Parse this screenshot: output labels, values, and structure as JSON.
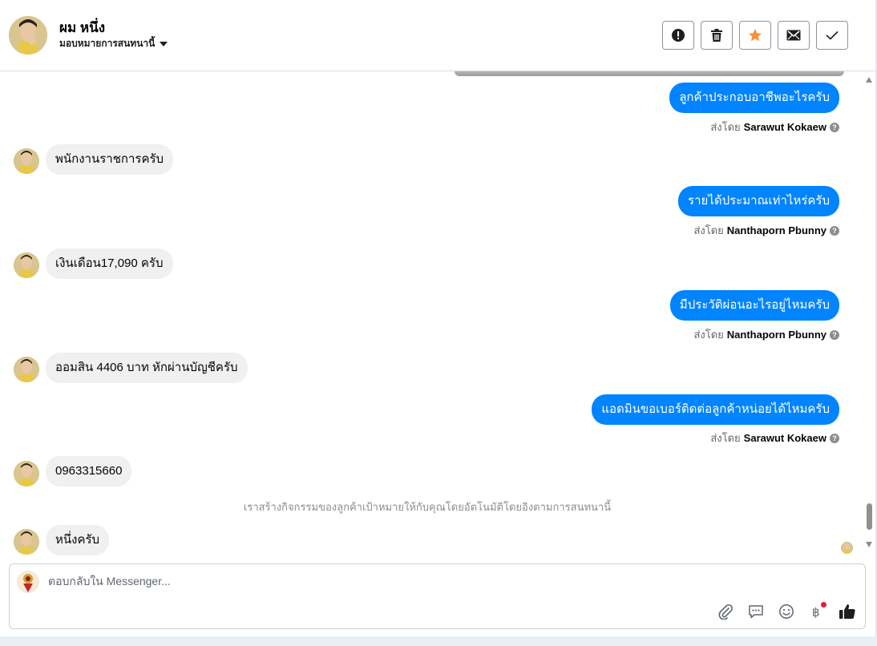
{
  "header": {
    "name": "ผม หนึ่ง",
    "subtitle": "มอบหมายการสนทนานี้",
    "actions": [
      {
        "name": "mark-spam-icon"
      },
      {
        "name": "trash-icon"
      },
      {
        "name": "star-icon",
        "color": "#f7923b"
      },
      {
        "name": "envelope-icon"
      },
      {
        "name": "checkmark-icon"
      }
    ]
  },
  "messages": [
    {
      "dir": "out",
      "text": "ลูกค้าประกอบอาชีพอะไรครับ",
      "sent_by_label": "ส่งโดย",
      "sender": "Sarawut Kokaew"
    },
    {
      "dir": "in",
      "text": "พนักงานราชการครับ"
    },
    {
      "dir": "out",
      "text": "รายได้ประมาณเท่าไหร่ครับ",
      "sent_by_label": "ส่งโดย",
      "sender": "Nanthaporn Pbunny"
    },
    {
      "dir": "in",
      "text": "เงินเดือน17,090 ครับ"
    },
    {
      "dir": "out",
      "text": "มีประวัติผ่อนอะไรอยู่ไหมครับ",
      "sent_by_label": "ส่งโดย",
      "sender": "Nanthaporn Pbunny"
    },
    {
      "dir": "in",
      "text": "ออมสิน 4406 บาท หักผ่านบัญชีครับ"
    },
    {
      "dir": "out",
      "text": "แอดมินขอเบอร์ติดต่อลูกค้าหน่อยได้ไหมครับ",
      "sent_by_label": "ส่งโดย",
      "sender": "Sarawut Kokaew"
    },
    {
      "dir": "in",
      "text": "0963315660"
    },
    {
      "dir": "in",
      "text": "หนึ่งครับ"
    }
  ],
  "system_note": "เราสร้างกิจกรรมของลูกค้าเป้าหมายให้กับคุณโดยอัตโนมัติโดยอิงตามการสนทนานี้",
  "composer": {
    "placeholder": "ตอบกลับใน Messenger...",
    "tools": [
      "paperclip-icon",
      "saved-reply-icon",
      "emoji-icon",
      "baht-payment-icon",
      "thumbs-up-icon"
    ]
  },
  "colors": {
    "outgoing_bubble": "#0084ff",
    "incoming_bubble": "#f0f0f0",
    "star": "#f7923b"
  }
}
